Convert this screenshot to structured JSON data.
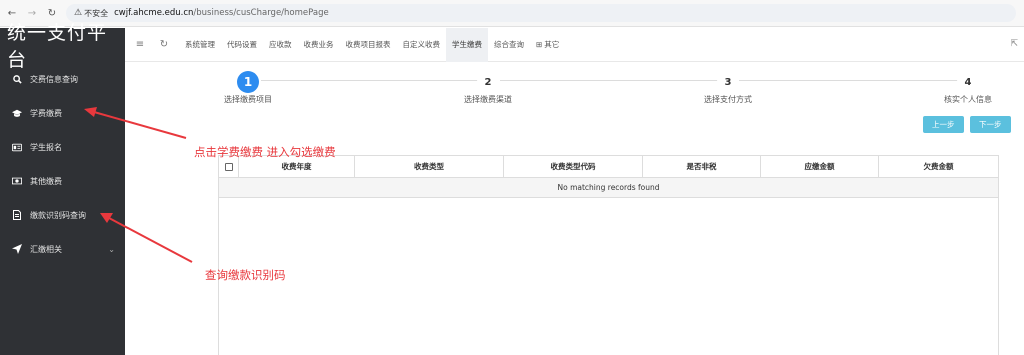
{
  "browser": {
    "back_icon": "arrow-left-icon",
    "forward_icon": "arrow-right-icon",
    "reload_icon": "reload-icon",
    "security_label": "不安全",
    "url_host": "cwjf.ahcme.edu.cn",
    "url_path": "/business/cusCharge/homePage"
  },
  "sidebar": {
    "brand": "统一支付平台",
    "items": [
      {
        "label": "交费信息查询",
        "icon": "search-icon"
      },
      {
        "label": "学费缴费",
        "icon": "graduation-cap-icon"
      },
      {
        "label": "学生报名",
        "icon": "id-card-icon"
      },
      {
        "label": "其他缴费",
        "icon": "money-icon"
      },
      {
        "label": "缴款识别码查询",
        "icon": "document-icon"
      },
      {
        "label": "汇缴相关",
        "icon": "send-icon"
      }
    ]
  },
  "topnav": {
    "tabs": [
      "系统管理",
      "代码设置",
      "应收款",
      "收费业务",
      "收费项目报表",
      "自定义收费",
      "学生缴费",
      "综合查询",
      "其它"
    ],
    "active_tab": "学生缴费"
  },
  "steps": [
    {
      "num": "1",
      "label": "选择缴费项目"
    },
    {
      "num": "2",
      "label": "选择缴费渠道"
    },
    {
      "num": "3",
      "label": "选择支付方式"
    },
    {
      "num": "4",
      "label": "核实个人信息"
    }
  ],
  "buttons": {
    "prev": "上一步",
    "next": "下一步"
  },
  "table": {
    "columns": [
      "收费年度",
      "收费类型",
      "收费类型代码",
      "是否非税",
      "应缴金额",
      "欠费金额"
    ],
    "empty_text": "No matching records found"
  },
  "annotations": {
    "first": "点击学费缴费 进入勾选缴费",
    "second": "查询缴款识别码"
  },
  "colors": {
    "accent": "#2d8cf0",
    "button": "#5bc0de",
    "annotation": "#e8383d",
    "sidebar": "#2f3135"
  }
}
